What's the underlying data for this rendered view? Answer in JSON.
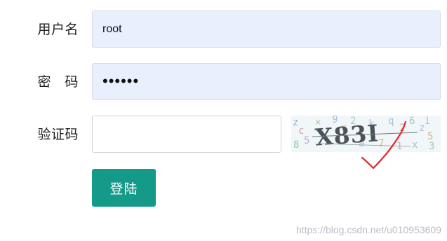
{
  "form": {
    "username": {
      "label": "用户名",
      "value": "root"
    },
    "password": {
      "label": "密　码",
      "value": "••••••"
    },
    "captcha": {
      "label": "验证码",
      "value": "",
      "image_text": "X83I"
    },
    "submit_label": "登陆"
  },
  "watermark": "https://blog.csdn.net/u010953609",
  "colors": {
    "input_fill": "#e8f0fe",
    "button": "#139a88",
    "check_mark": "#e02b2b"
  }
}
